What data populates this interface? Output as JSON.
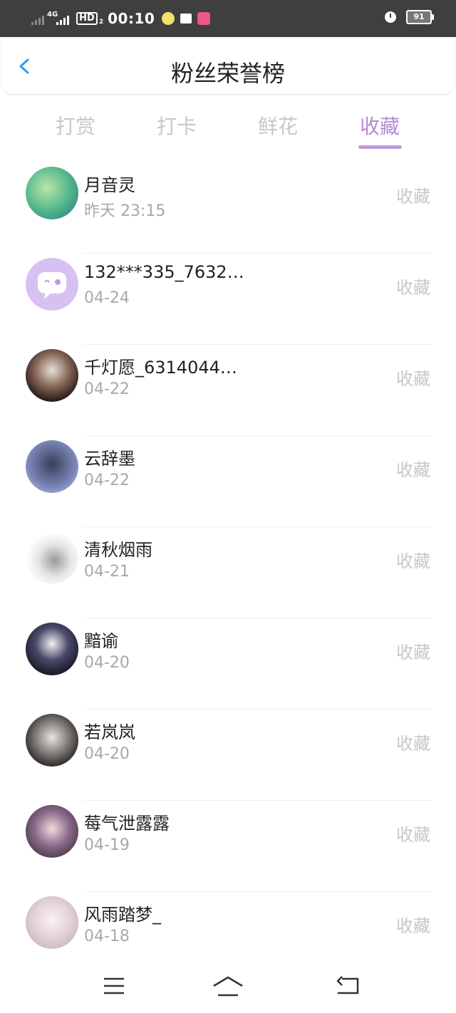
{
  "status_bar": {
    "network": "4G",
    "hd": "HD",
    "hd_sub": "2",
    "time": "00:10",
    "battery": "91"
  },
  "header": {
    "title": "粉丝荣誉榜"
  },
  "tabs": [
    {
      "label": "打赏",
      "active": false
    },
    {
      "label": "打卡",
      "active": false
    },
    {
      "label": "鲜花",
      "active": false
    },
    {
      "label": "收藏",
      "active": true
    }
  ],
  "accent_color": "#b58ad6",
  "fans": [
    {
      "name": "月音灵",
      "date": "昨天 23:15",
      "action": "收藏"
    },
    {
      "name": "132***335_7632…",
      "date": "04-24",
      "action": "收藏"
    },
    {
      "name": "千灯愿_6314044…",
      "date": "04-22",
      "action": "收藏"
    },
    {
      "name": "云辞墨",
      "date": "04-22",
      "action": "收藏"
    },
    {
      "name": "清秋烟雨",
      "date": "04-21",
      "action": "收藏"
    },
    {
      "name": "黯谕",
      "date": "04-20",
      "action": "收藏"
    },
    {
      "name": "若岚岚",
      "date": "04-20",
      "action": "收藏"
    },
    {
      "name": "莓气泄露露",
      "date": "04-19",
      "action": "收藏"
    },
    {
      "name": "风雨踏梦_",
      "date": "04-18",
      "action": "收藏"
    }
  ],
  "nav": {
    "icons": [
      "menu-icon",
      "home-icon",
      "back-icon"
    ]
  }
}
